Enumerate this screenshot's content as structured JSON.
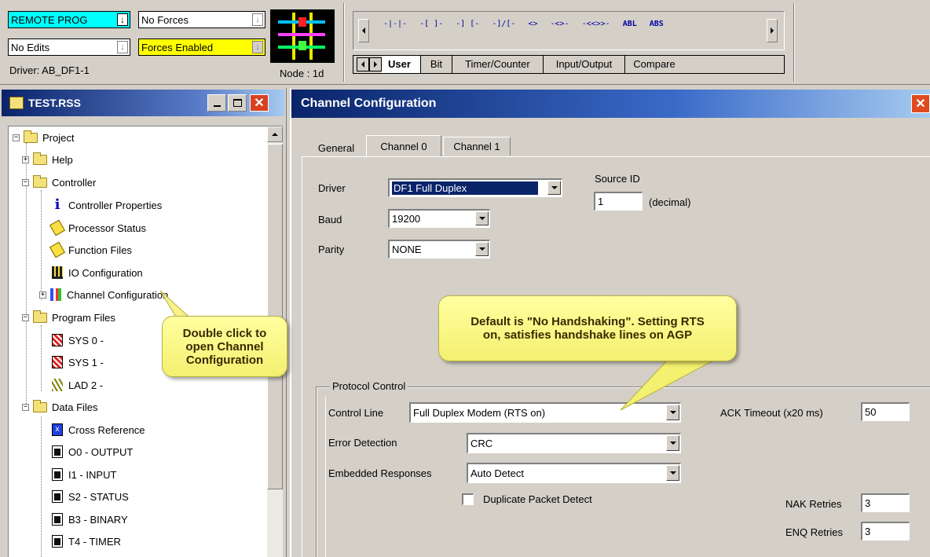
{
  "toolbar": {
    "mode": "REMOTE PROG",
    "forces": "No Forces",
    "edits": "No Edits",
    "forces_enabled": "Forces Enabled",
    "driver": "Driver: AB_DF1-1",
    "node": "Node : 1d",
    "instructions": [
      "-|-|-",
      "-[ ]-",
      "-] [-",
      "-]/[-",
      "<>",
      "-<>-",
      "-<<>>-",
      "ABL",
      "ABS"
    ],
    "instruction_tabs": [
      "User",
      "Bit",
      "Timer/Counter",
      "Input/Output",
      "Compare"
    ]
  },
  "project_window": {
    "title": "TEST.RSS",
    "items": {
      "project": "Project",
      "help": "Help",
      "controller": "Controller",
      "controller_properties": "Controller Properties",
      "processor_status": "Processor Status",
      "function_files": "Function Files",
      "io_configuration": "IO Configuration",
      "channel_configuration": "Channel Configuration",
      "program_files": "Program Files",
      "sys0": "SYS 0 -",
      "sys1": "SYS 1 -",
      "lad2": "LAD 2 -",
      "data_files": "Data Files",
      "cross_reference": "Cross Reference",
      "o0": "O0 - OUTPUT",
      "i1": "I1 - INPUT",
      "s2": "S2 - STATUS",
      "b3": "B3 - BINARY",
      "t4": "T4 - TIMER"
    }
  },
  "callouts": {
    "left": "Double click to open Channel Configuration",
    "right": "Default is \"No Handshaking\". Setting RTS on, satisfies handshake lines on AGP"
  },
  "dialog": {
    "title": "Channel Configuration",
    "tabs": [
      "General",
      "Channel 0",
      "Channel 1"
    ],
    "driver_label": "Driver",
    "driver_value": "DF1 Full Duplex",
    "baud_label": "Baud",
    "baud_value": "19200",
    "parity_label": "Parity",
    "parity_value": "NONE",
    "source_id_label": "Source ID",
    "source_id_value": "1",
    "source_id_unit": "(decimal)",
    "protocol_group": "Protocol Control",
    "control_line_label": "Control Line",
    "control_line_value": "Full Duplex Modem (RTS on)",
    "error_detection_label": "Error Detection",
    "error_detection_value": "CRC",
    "embedded_label": "Embedded Responses",
    "embedded_value": "Auto Detect",
    "duplicate_label": "Duplicate Packet Detect",
    "ack_label": "ACK Timeout (x20 ms)",
    "ack_value": "50",
    "nak_label": "NAK Retries",
    "nak_value": "3",
    "enq_label": "ENQ Retries",
    "enq_value": "3"
  }
}
